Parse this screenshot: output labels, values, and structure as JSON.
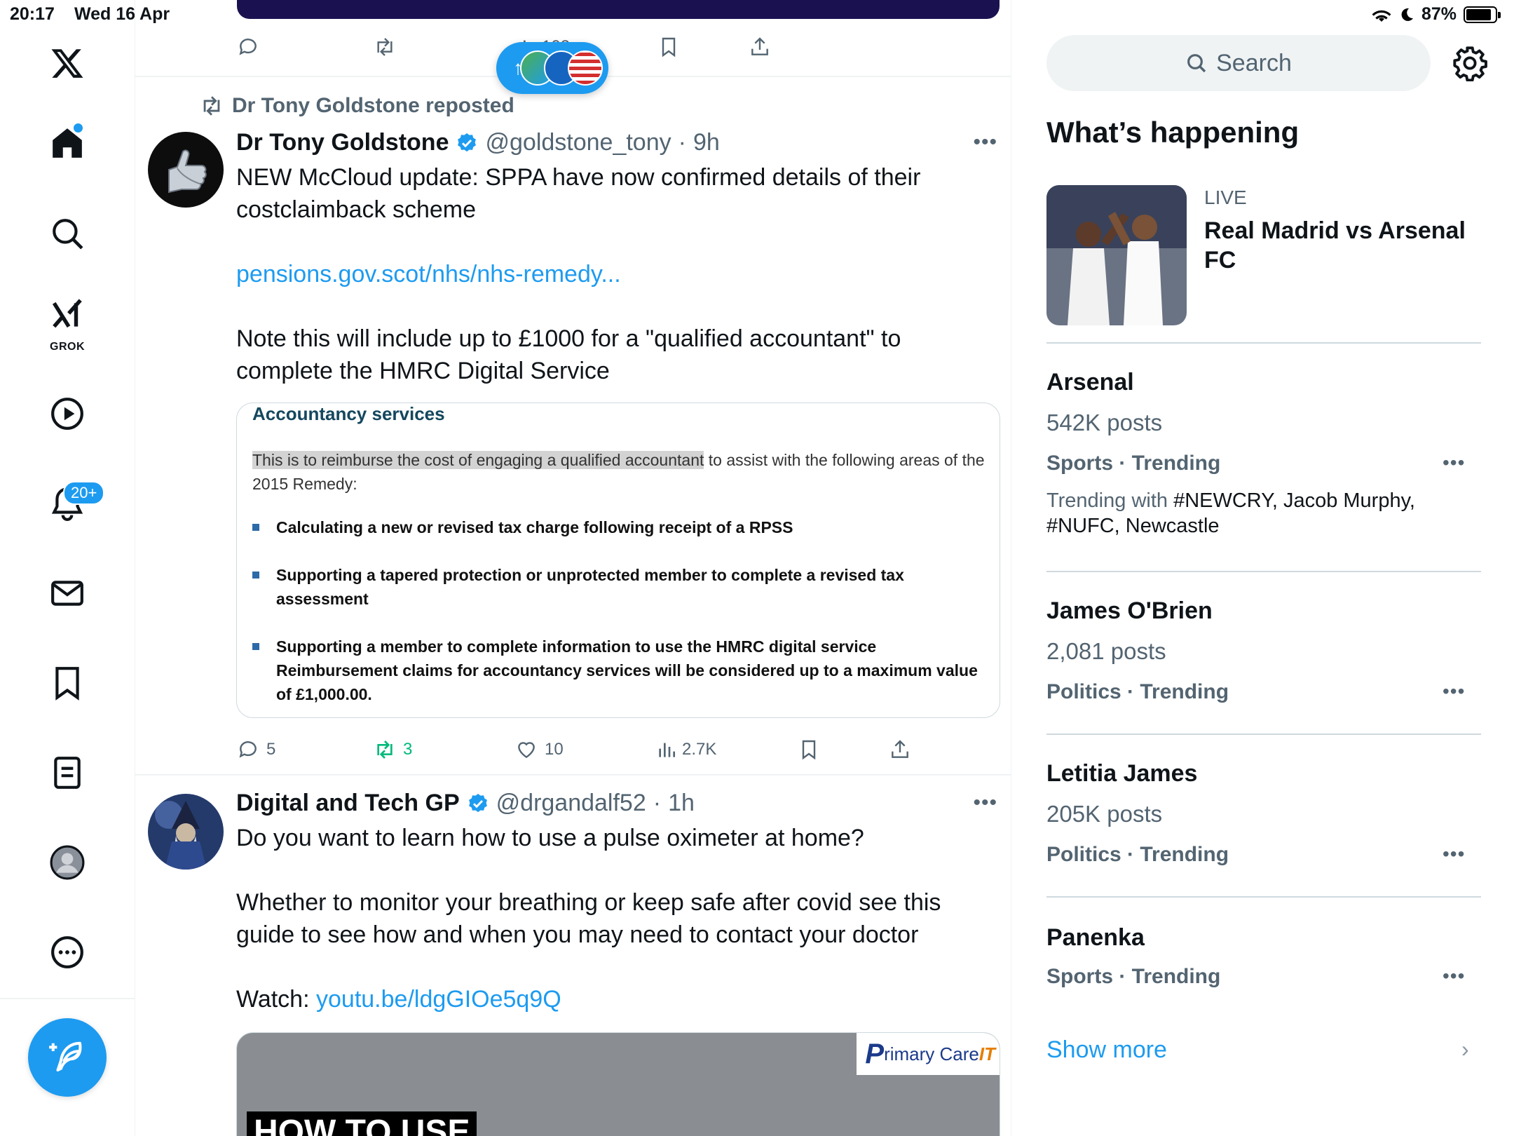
{
  "status_bar": {
    "time": "20:17",
    "date": "Wed 16 Apr",
    "battery": "87%",
    "battery_level": 0.87
  },
  "nav": {
    "grok_label": "GROK",
    "notifications_badge": "20+"
  },
  "timeline": {
    "top_actions": {
      "views": "103"
    },
    "pill_arrow": "↑",
    "tweets": [
      {
        "repost_by": "Dr Tony Goldstone reposted",
        "display_name": "Dr Tony Goldstone",
        "handle": "@goldstone_tony",
        "time": "9h",
        "text_line1": "NEW McCloud update: SPPA have now confirmed details of their",
        "text_line2": "costclaimback scheme",
        "link": "pensions.gov.scot/nhs/nhs-remedy...",
        "text_line3": "Note this will include up to £1000 for a \"qualified accountant\" to",
        "text_line4": "complete the HMRC Digital Service",
        "doc": {
          "title": "Accountancy services",
          "para_highlight": "This is to reimburse the cost of engaging a qualified accountant",
          "para_rest": " to assist with the following areas of the 2015 Remedy:",
          "bullets": [
            "Calculating a new or revised tax charge following receipt of a RPSS",
            "Supporting a tapered protection or unprotected member to complete a revised tax assessment",
            "Supporting a member to complete information to use the HMRC digital service Reimbursement claims for accountancy services will be considered up to a maximum value of £1,000.00."
          ]
        },
        "replies": "5",
        "reposts": "3",
        "likes": "10",
        "views": "2.7K"
      },
      {
        "display_name": "Digital and Tech GP",
        "handle": "@drgandalf52",
        "time": "1h",
        "text_line1": "Do you want to learn how to use a pulse oximeter at home?",
        "text_line2": "Whether to monitor your breathing or keep safe after covid see this",
        "text_line3": "guide to see how and when you may need to contact your doctor",
        "watch_label": "Watch: ",
        "watch_link": "youtu.be/ldgGIOe5q9Q",
        "video_overlay": "HOW TO USE",
        "video_brand_p": "P",
        "video_brand_rest": "rimary Care ",
        "video_brand_it": "IT"
      }
    ]
  },
  "right": {
    "search_placeholder": "Search",
    "section_title": "What’s happening",
    "live": {
      "label": "LIVE",
      "title": "Real Madrid vs Arsenal FC"
    },
    "trends": [
      {
        "name": "Arsenal",
        "count": "542K posts",
        "category": "Sports · Trending",
        "with_label": "Trending with ",
        "with": "#NEWCRY, Jacob Murphy, #NUFC, Newcastle"
      },
      {
        "name": "James O'Brien",
        "count": "2,081 posts",
        "category": "Politics · Trending"
      },
      {
        "name": "Letitia James",
        "count": "205K posts",
        "category": "Politics · Trending"
      },
      {
        "name": "Panenka",
        "category": "Sports · Trending"
      }
    ],
    "show_more": "Show more"
  },
  "colors": {
    "accent": "#1d9bf0",
    "secondary_text": "#536471",
    "repost_green": "#00ba7c"
  }
}
